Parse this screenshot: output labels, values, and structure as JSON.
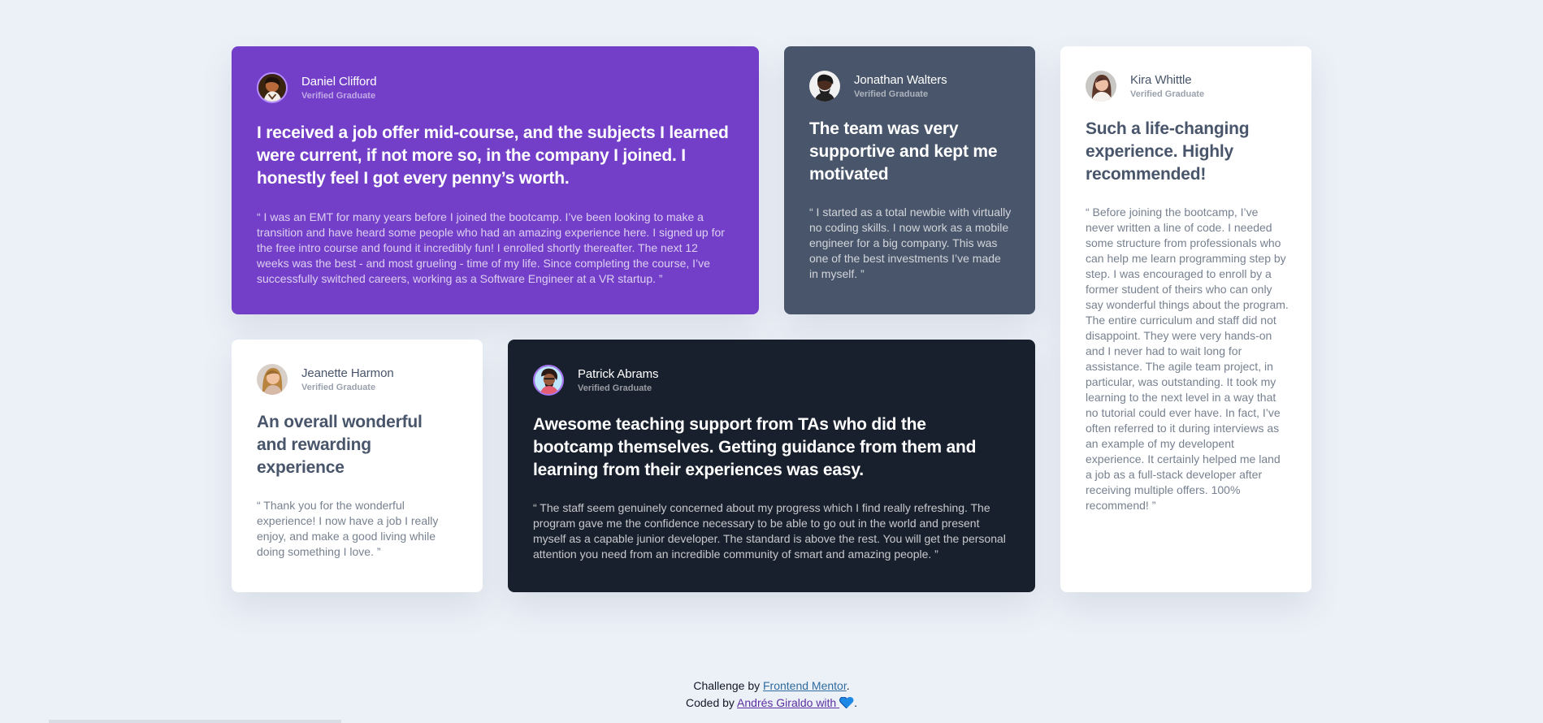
{
  "page": {
    "background": "#ecf1f8"
  },
  "cards": {
    "daniel": {
      "name": "Daniel Clifford",
      "verified": "Verified Graduate",
      "headline": "I received a job offer mid-course, and the subjects I learned were current, if not more so, in the company I joined. I honestly feel I got every penny’s worth.",
      "body": "“ I was an EMT for many years before I joined the bootcamp. I’ve been looking to make a transition and have heard some people who had an amazing experience here. I signed up for the free intro course and found it incredibly fun! I enrolled shortly thereafter. The next 12 weeks was the best - and most grueling - time of my life. Since completing the course, I’ve successfully switched careers, working as a Software Engineer at a VR startup. ”",
      "background": "#733fc8",
      "avatar_icon": "profile-avatar",
      "quote_icon": "quotation-icon"
    },
    "jonathan": {
      "name": "Jonathan Walters",
      "verified": "Verified Graduate",
      "headline": "The team was very supportive and kept me motivated",
      "body": "“ I started as a total newbie with virtually no coding skills. I now work as a mobile engineer for a big company. This was one of the best investments I’ve made in myself. ”",
      "background": "#48556a",
      "avatar_icon": "profile-avatar"
    },
    "kira": {
      "name": "Kira Whittle",
      "verified": "Verified Graduate",
      "headline": "Such a life-changing experience. Highly recommended!",
      "body": "“ Before joining the bootcamp, I’ve never written a line of code. I needed some structure from professionals who can help me learn programming step by step. I was encouraged to enroll by a former student of theirs who can only say wonderful things about the program. The entire curriculum and staff did not disappoint. They were very hands-on and I never had to wait long for assistance. The agile team project, in particular, was outstanding. It took my learning to the next level in a way that no tutorial could ever have. In fact, I’ve often referred to it during interviews as an example of my developent experience. It certainly helped me land a job as a full-stack developer after receiving multiple offers. 100% recommend! ”",
      "background": "#ffffff",
      "avatar_icon": "profile-avatar"
    },
    "jeanette": {
      "name": "Jeanette Harmon",
      "verified": "Verified Graduate",
      "headline": "An overall wonderful and rewarding experience",
      "body": "“ Thank you for the wonderful experience! I now have a job I really enjoy, and make a good living while doing something I love. ”",
      "background": "#ffffff",
      "avatar_icon": "profile-avatar"
    },
    "patrick": {
      "name": "Patrick Abrams",
      "verified": "Verified Graduate",
      "headline": "Awesome teaching support from TAs who did the bootcamp themselves. Getting guidance from them and learning from their experiences was easy.",
      "body": "“ The staff seem genuinely concerned about my progress which I find really refreshing. The program gave me the confidence necessary to be able to go out in the world and present myself as a capable junior developer. The standard is above the rest. You will get the personal attention you need from an incredible community of smart and amazing people. ”",
      "background": "#19202d",
      "avatar_icon": "profile-avatar"
    }
  },
  "footer": {
    "challenge_prefix": "Challenge by ",
    "challenge_link": "Frontend Mentor",
    "challenge_suffix": ".",
    "coded_prefix": "Coded by ",
    "coded_link": "Andrés Giraldo with",
    "coded_suffix": ".",
    "heart_icon": "blue-heart-icon"
  }
}
